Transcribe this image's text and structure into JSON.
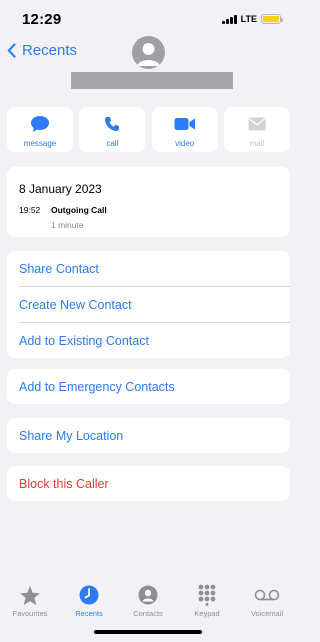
{
  "status_bar": {
    "time": "12:29",
    "network": "LTE"
  },
  "header": {
    "back_label": "Recents"
  },
  "actions": [
    {
      "label": "message",
      "icon": "message-icon",
      "enabled": true
    },
    {
      "label": "call",
      "icon": "phone-icon",
      "enabled": true
    },
    {
      "label": "video",
      "icon": "video-icon",
      "enabled": true
    },
    {
      "label": "mail",
      "icon": "mail-icon",
      "enabled": false
    }
  ],
  "call_log": {
    "date": "8 January 2023",
    "entries": [
      {
        "time": "19:52",
        "type": "Outgoing Call",
        "duration": "1 minute"
      }
    ]
  },
  "contact_options": {
    "share_contact": "Share Contact",
    "create_new_contact": "Create New Contact",
    "add_to_existing": "Add to Existing Contact"
  },
  "emergency": {
    "label": "Add to Emergency Contacts"
  },
  "location": {
    "label": "Share My Location"
  },
  "block": {
    "label": "Block this Caller"
  },
  "tab_bar": {
    "items": [
      {
        "label": "Favourites",
        "icon": "star-icon",
        "active": false
      },
      {
        "label": "Recents",
        "icon": "clock-icon",
        "active": true
      },
      {
        "label": "Contacts",
        "icon": "person-icon",
        "active": false
      },
      {
        "label": "Keypad",
        "icon": "keypad-icon",
        "active": false
      },
      {
        "label": "Voicemail",
        "icon": "voicemail-icon",
        "active": false
      }
    ]
  },
  "colors": {
    "accent": "#2b7cf6",
    "destructive": "#ea3b30",
    "background": "#f2f2f6",
    "battery": "#f5d213"
  }
}
